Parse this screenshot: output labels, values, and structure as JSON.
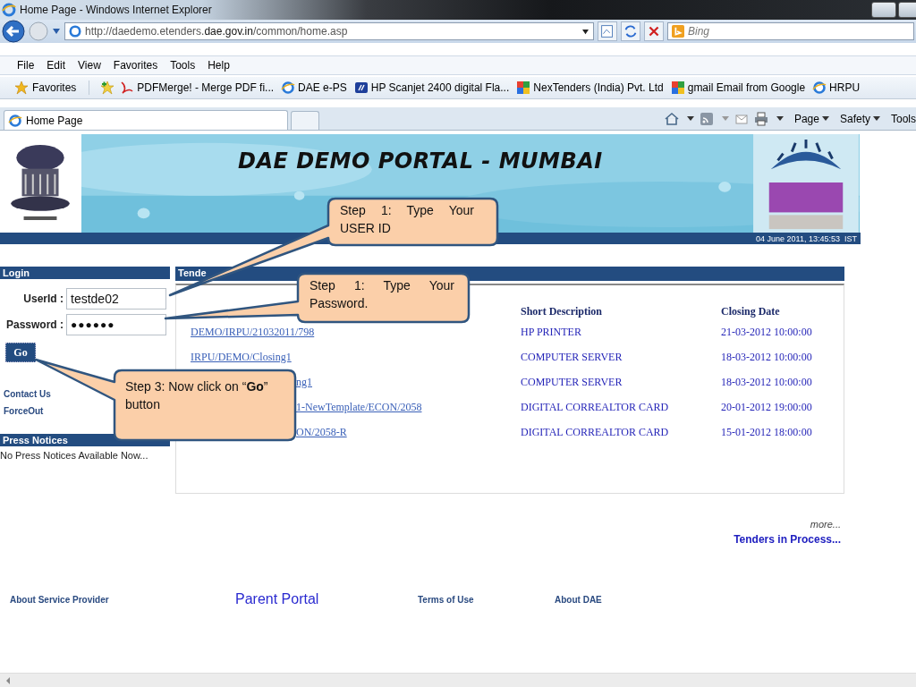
{
  "window": {
    "title": "Home Page - Windows Internet Explorer"
  },
  "address_bar": {
    "url": "http://daedemo.etenders.**dae.gov.in**/common/home.asp",
    "search_placeholder": "Bing"
  },
  "menu": [
    "File",
    "Edit",
    "View",
    "Favorites",
    "Tools",
    "Help"
  ],
  "favorites_bar": {
    "label": "Favorites",
    "items": [
      {
        "label": "PDFMerge! - Merge PDF fi...",
        "kind": "pdf"
      },
      {
        "label": "DAE e-PS",
        "kind": "ie"
      },
      {
        "label": "HP Scanjet 2400 digital Fla...",
        "kind": "hp"
      },
      {
        "label": "NexTenders (India) Pvt. Ltd",
        "kind": "google"
      },
      {
        "label": "gmail Email from Google",
        "kind": "google"
      },
      {
        "label": "HRPU",
        "kind": "ie"
      }
    ]
  },
  "tabs": [
    {
      "label": "Home Page",
      "selected": true
    }
  ],
  "command_bar": [
    {
      "label": "Page",
      "caret": true
    },
    {
      "label": "Safety",
      "caret": true
    },
    {
      "label": "Tools",
      "caret": false
    }
  ],
  "banner": {
    "title": "DAE DEMO PORTAL - MUMBAI",
    "datetime": "04 June 2011, 13:45:53  IST"
  },
  "login": {
    "heading": "Login",
    "userid_label": "UserId :",
    "userid": "testde02",
    "password_label": "Password :",
    "password": "●●●●●●",
    "button": "Go"
  },
  "side_links": [
    "Contact Us",
    "ForceOut"
  ],
  "press_notices": {
    "heading": "Press Notices",
    "text": "No Press Notices Available Now..."
  },
  "tenders": {
    "heading": "Tende",
    "columns": [
      "Short Description",
      "Closing Date"
    ],
    "rows": [
      {
        "number": "DEMO/IRPU/21032011/798",
        "partial": false,
        "description": "HP PRINTER",
        "closing": "21-03-2012 10:00:00"
      },
      {
        "number": "IRPU/DEMO/Closing1",
        "partial": false,
        "description": "COMPUTER SERVER",
        "closing": "18-03-2012 10:00:00"
      },
      {
        "number": "ng1",
        "partial": true,
        "description": "COMPUTER SERVER",
        "closing": "18-03-2012 10:00:00"
      },
      {
        "number": "1-NewTemplate/ECON/2058",
        "partial": true,
        "description": "DIGITAL CORREALTOR CARD",
        "closing": "20-01-2012 19:00:00"
      },
      {
        "number": "ON/2058-R",
        "partial": true,
        "description": "DIGITAL CORREALTOR CARD",
        "closing": "15-01-2012 18:00:00"
      }
    ],
    "more": "more...",
    "in_process": "Tenders in Process..."
  },
  "footer": [
    {
      "label": "About Service Provider",
      "kind": "small"
    },
    {
      "label": "Parent Portal",
      "kind": "large"
    },
    {
      "label": "Terms of Use",
      "kind": "small"
    },
    {
      "label": "About DAE",
      "kind": "small"
    }
  ],
  "callouts": [
    {
      "text": "Step  1:  Type  Your USER ID"
    },
    {
      "text": "Step  1:  Type  Your Password."
    },
    {
      "text": "Step 3: Now click on “**Go**” button"
    }
  ]
}
